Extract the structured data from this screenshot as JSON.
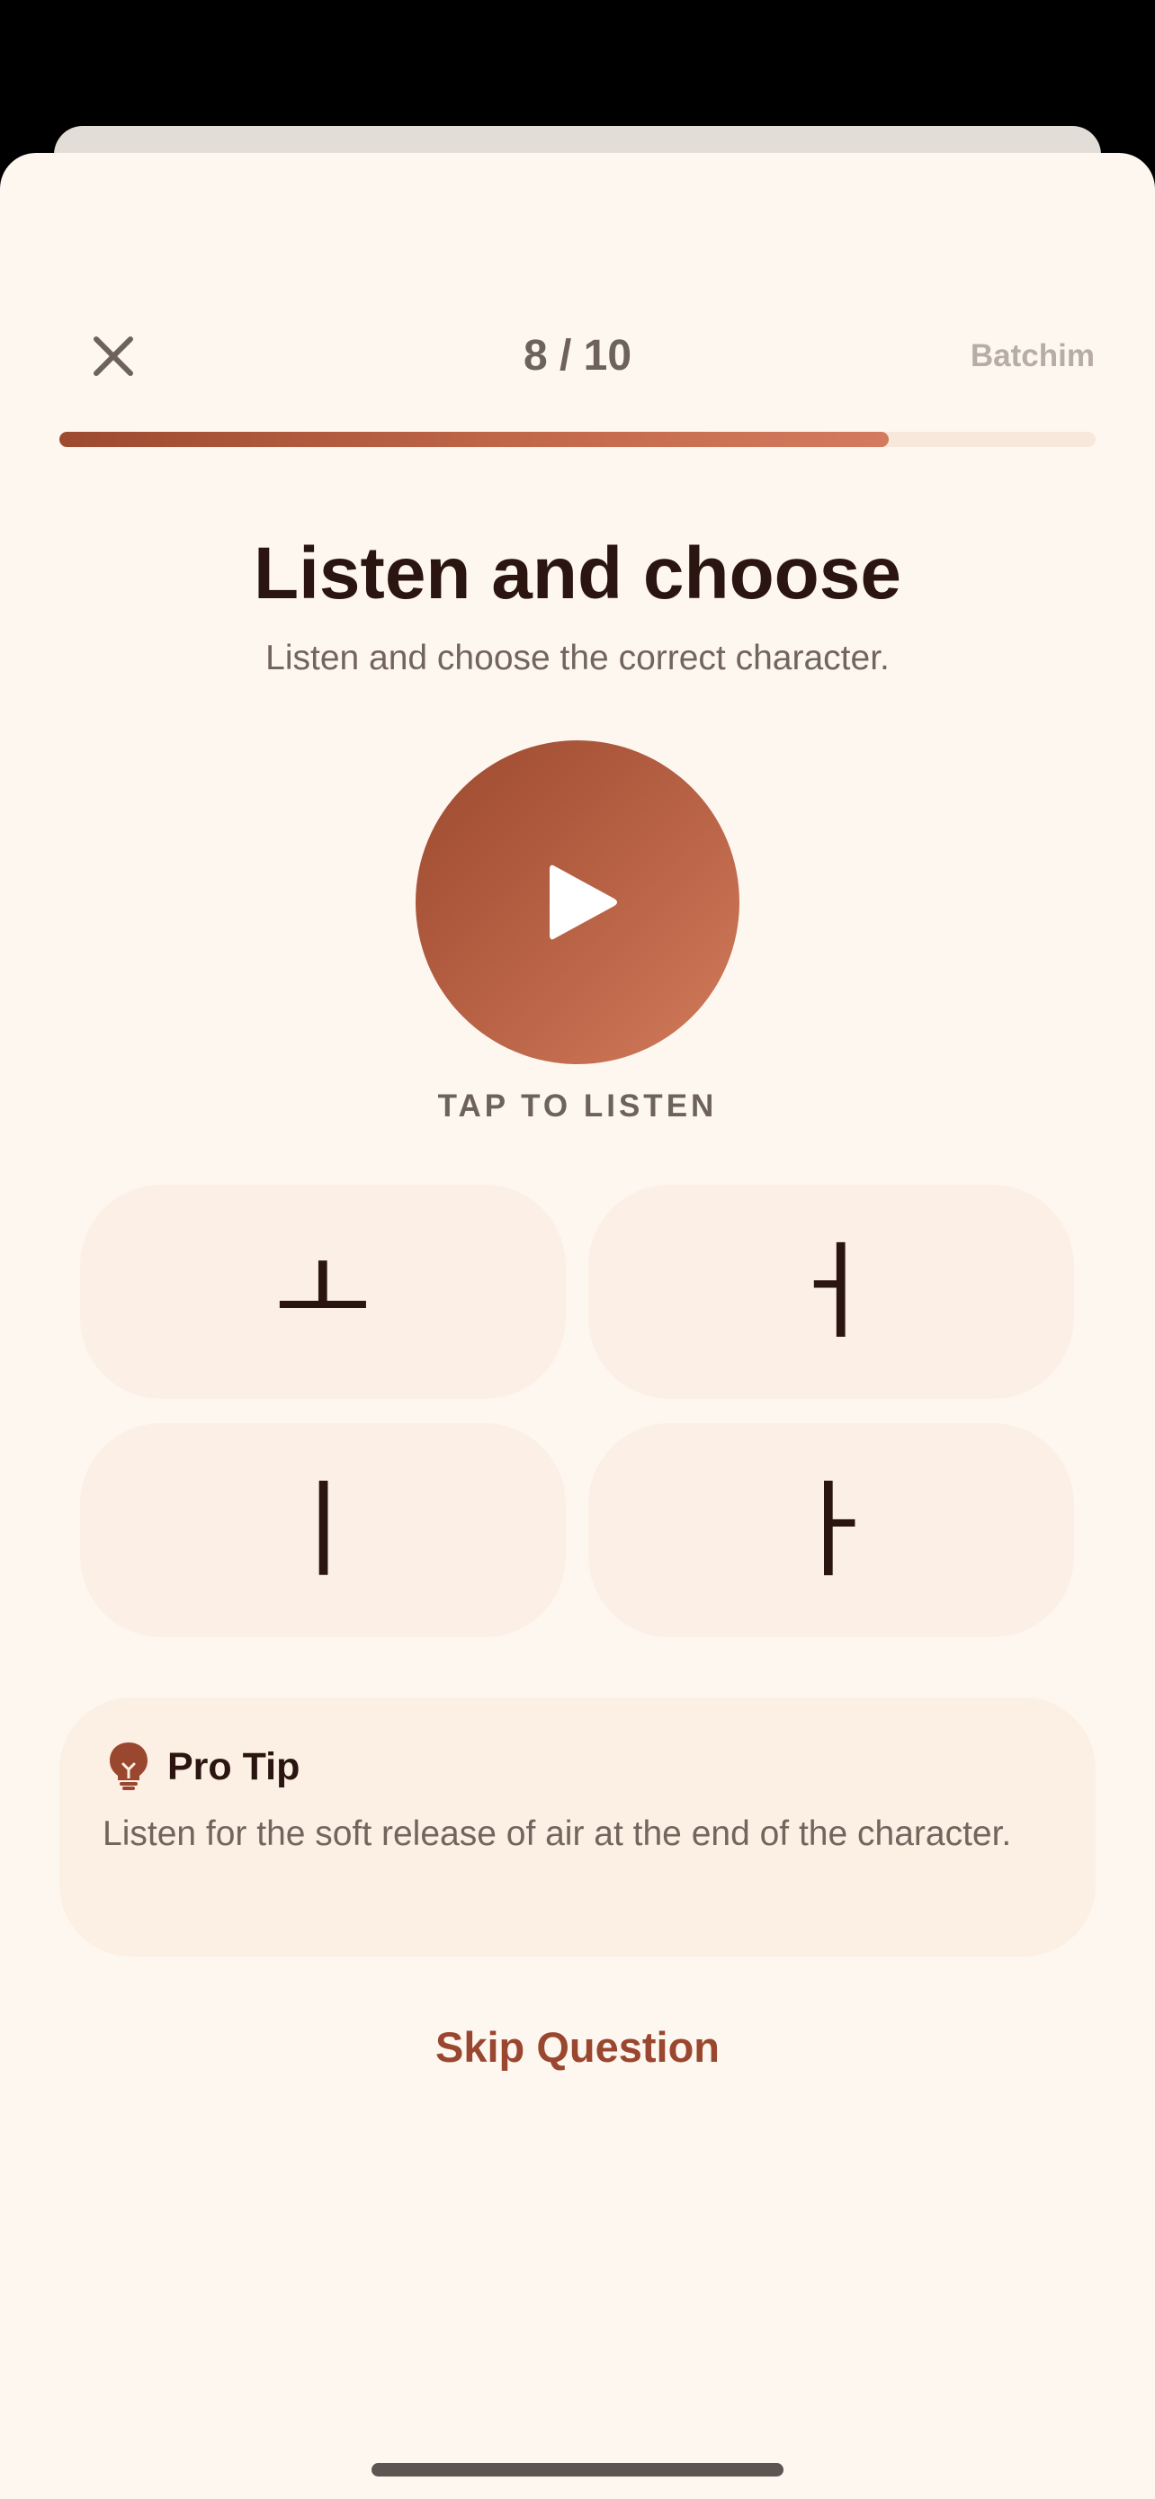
{
  "header": {
    "counter": "8 / 10",
    "category": "Batchim",
    "progress_fraction": 0.8
  },
  "question": {
    "title": "Listen and choose",
    "subtitle": "Listen and choose the correct character.",
    "tap_label": "TAP TO LISTEN"
  },
  "options": [
    {
      "char": "ㅗ"
    },
    {
      "char": "ㅓ"
    },
    {
      "char": "ㅣ"
    },
    {
      "char": "ㅏ"
    }
  ],
  "tip": {
    "title": "Pro Tip",
    "body": "Listen for the soft release of air at the end of the character."
  },
  "skip_label": "Skip Question",
  "icons": {
    "close": "close-icon",
    "play": "play-icon",
    "tip": "lightbulb-icon"
  },
  "colors": {
    "background": "#fef7f0",
    "accent": "#9a4730",
    "accent_light": "#d27b5c",
    "text_dark": "#2b1510",
    "text_muted": "#72655e",
    "option_bg": "#fcf0e6"
  }
}
